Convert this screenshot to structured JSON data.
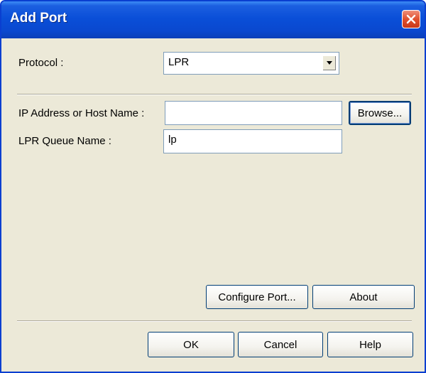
{
  "window": {
    "title": "Add Port"
  },
  "protocol": {
    "label": "Protocol :",
    "value": "LPR"
  },
  "ip_address": {
    "label": "IP Address or Host Name :",
    "value": ""
  },
  "browse": {
    "label": "Browse..."
  },
  "queue": {
    "label": "LPR Queue Name :",
    "value": "lp"
  },
  "buttons": {
    "configure_port": "Configure Port...",
    "about": "About",
    "ok": "OK",
    "cancel": "Cancel",
    "help": "Help"
  }
}
